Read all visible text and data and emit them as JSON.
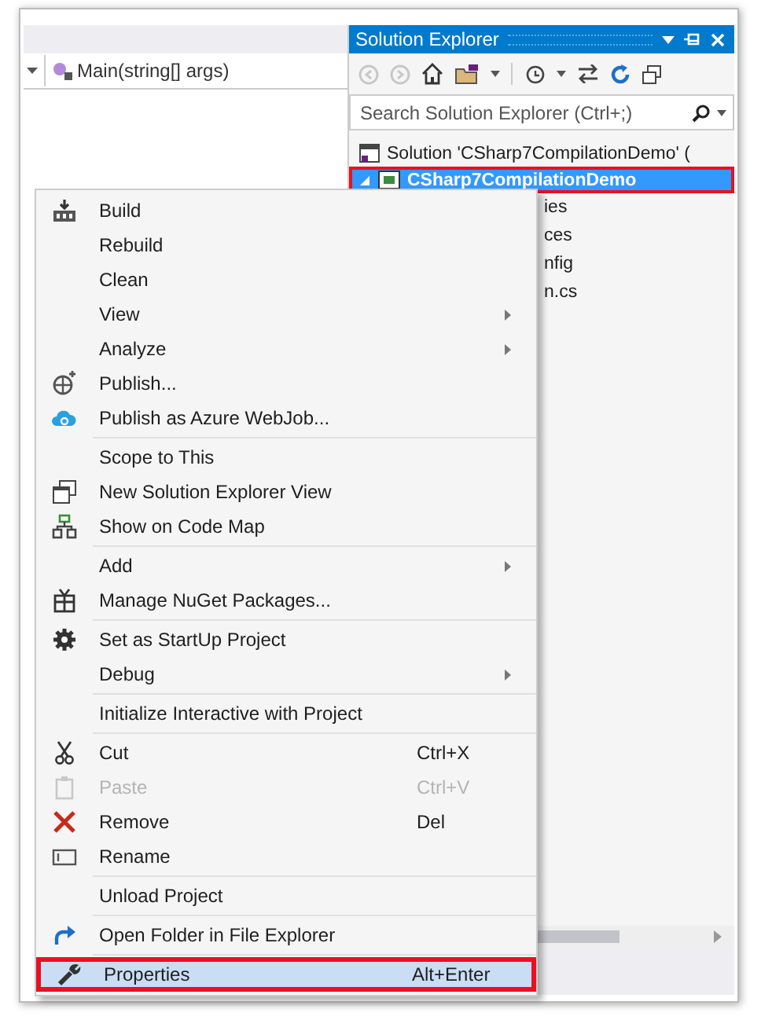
{
  "editor": {
    "member_dropdown": "Main(string[] args)"
  },
  "solution_explorer": {
    "title": "Solution Explorer",
    "search": {
      "placeholder": "Search Solution Explorer (Ctrl+;)"
    },
    "tree": [
      {
        "label": "Solution 'CSharp7CompilationDemo' (",
        "selected": false,
        "outlined": false,
        "children": [
          {
            "label": "CSharp7CompilationDemo",
            "selected": true,
            "outlined": true,
            "expanded": true,
            "children": [
              {
                "label": "ies",
                "selected": false,
                "outlined": false
              },
              {
                "label": "ces",
                "selected": false,
                "outlined": false
              },
              {
                "label": "nfig",
                "selected": false,
                "outlined": false
              },
              {
                "label": "n.cs",
                "selected": false,
                "outlined": false
              }
            ]
          }
        ]
      }
    ]
  },
  "context_menu": {
    "groups": [
      {
        "items": [
          {
            "label": "Build",
            "disabled": false,
            "submenu": false,
            "selected": false,
            "outlined": false
          },
          {
            "label": "Rebuild",
            "disabled": false,
            "submenu": false,
            "selected": false,
            "outlined": false
          },
          {
            "label": "Clean",
            "disabled": false,
            "submenu": false,
            "selected": false,
            "outlined": false
          },
          {
            "label": "View",
            "disabled": false,
            "submenu": true,
            "selected": false,
            "outlined": false
          },
          {
            "label": "Analyze",
            "disabled": false,
            "submenu": true,
            "selected": false,
            "outlined": false
          },
          {
            "label": "Publish...",
            "disabled": false,
            "submenu": false,
            "selected": false,
            "outlined": false
          },
          {
            "label": "Publish as Azure WebJob...",
            "disabled": false,
            "submenu": false,
            "selected": false,
            "outlined": false
          }
        ]
      },
      {
        "items": [
          {
            "label": "Scope to This",
            "disabled": false,
            "submenu": false,
            "selected": false,
            "outlined": false
          },
          {
            "label": "New Solution Explorer View",
            "disabled": false,
            "submenu": false,
            "selected": false,
            "outlined": false
          },
          {
            "label": "Show on Code Map",
            "disabled": false,
            "submenu": false,
            "selected": false,
            "outlined": false
          }
        ]
      },
      {
        "items": [
          {
            "label": "Add",
            "disabled": false,
            "submenu": true,
            "selected": false,
            "outlined": false
          },
          {
            "label": "Manage NuGet Packages...",
            "disabled": false,
            "submenu": false,
            "selected": false,
            "outlined": false
          }
        ]
      },
      {
        "items": [
          {
            "label": "Set as StartUp Project",
            "disabled": false,
            "submenu": false,
            "selected": false,
            "outlined": false
          },
          {
            "label": "Debug",
            "disabled": false,
            "submenu": true,
            "selected": false,
            "outlined": false
          }
        ]
      },
      {
        "items": [
          {
            "label": "Initialize Interactive with Project",
            "disabled": false,
            "submenu": false,
            "selected": false,
            "outlined": false
          }
        ]
      },
      {
        "items": [
          {
            "label": "Cut",
            "shortcut": "Ctrl+X",
            "disabled": false,
            "submenu": false,
            "selected": false,
            "outlined": false
          },
          {
            "label": "Paste",
            "shortcut": "Ctrl+V",
            "disabled": true,
            "submenu": false,
            "selected": false,
            "outlined": false
          },
          {
            "label": "Remove",
            "shortcut": "Del",
            "disabled": false,
            "submenu": false,
            "selected": false,
            "outlined": false
          },
          {
            "label": "Rename",
            "disabled": false,
            "submenu": false,
            "selected": false,
            "outlined": false
          }
        ]
      },
      {
        "items": [
          {
            "label": "Unload Project",
            "disabled": false,
            "submenu": false,
            "selected": false,
            "outlined": false
          }
        ]
      },
      {
        "items": [
          {
            "label": "Open Folder in File Explorer",
            "disabled": false,
            "submenu": false,
            "selected": false,
            "outlined": false
          }
        ]
      },
      {
        "items": [
          {
            "label": "Properties",
            "shortcut": "Alt+Enter",
            "disabled": false,
            "submenu": false,
            "selected": true,
            "outlined": true
          }
        ]
      }
    ]
  }
}
